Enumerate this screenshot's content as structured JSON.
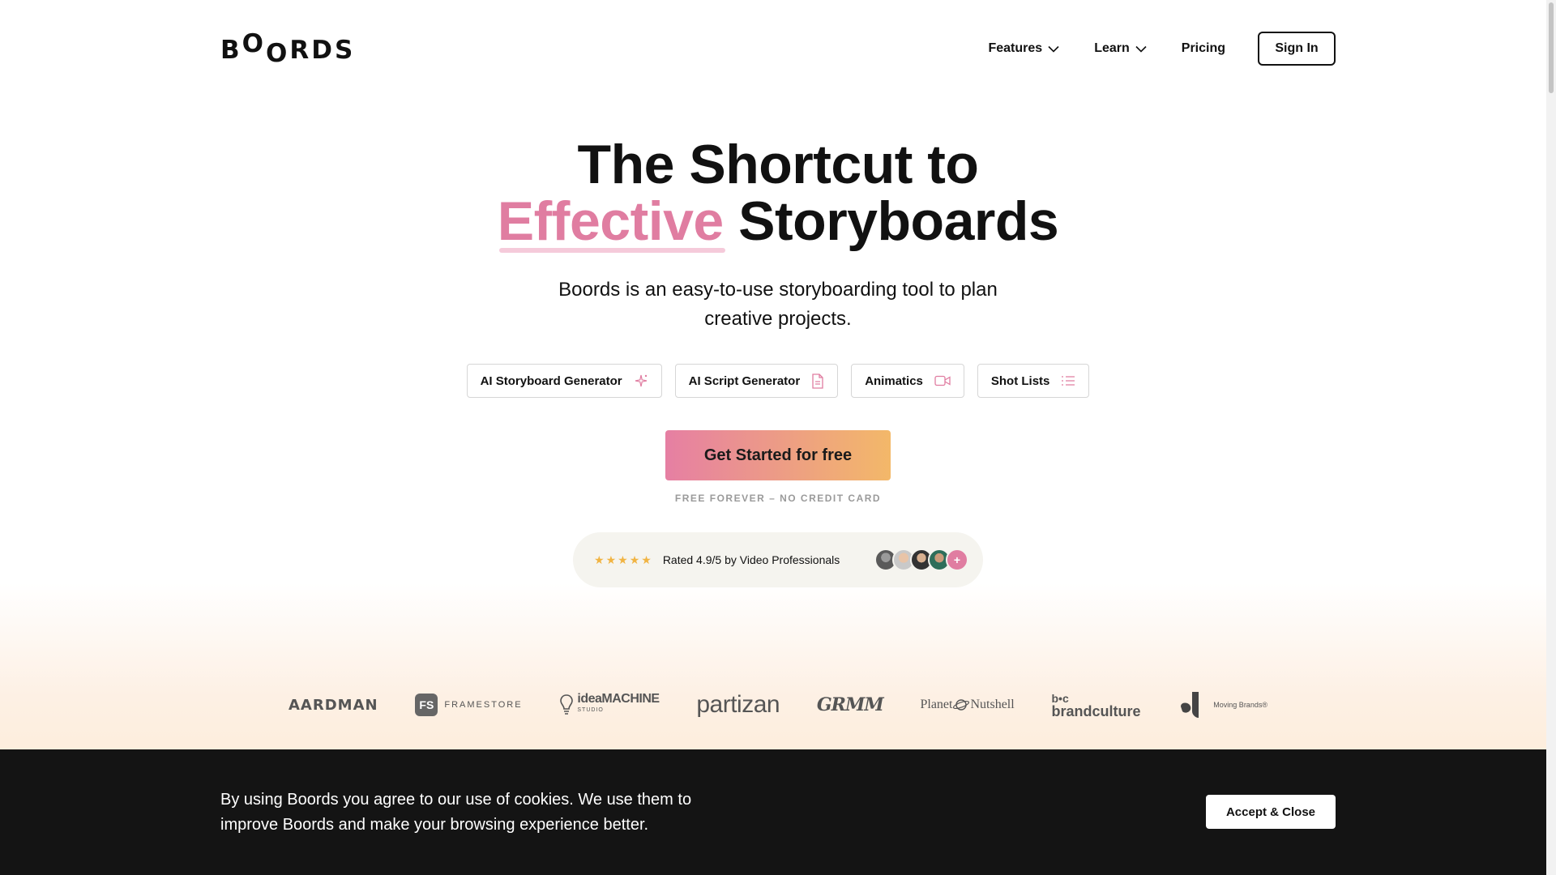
{
  "header": {
    "logo_letters": [
      "B",
      "O",
      "O",
      "R",
      "D",
      "S"
    ],
    "nav": [
      {
        "label": "Features",
        "has_dropdown": true
      },
      {
        "label": "Learn",
        "has_dropdown": true
      },
      {
        "label": "Pricing",
        "has_dropdown": false
      }
    ],
    "signin_label": "Sign In"
  },
  "hero": {
    "title_line1": "The Shortcut to",
    "title_accent": "Effective",
    "title_line2_rest": "Storyboards",
    "subtitle": "Boords is an easy-to-use storyboarding tool to plan creative projects.",
    "accent_color": "#e07da1"
  },
  "chips": [
    {
      "label": "AI Storyboard Generator",
      "icon": "sparkle-icon"
    },
    {
      "label": "AI Script Generator",
      "icon": "document-icon"
    },
    {
      "label": "Animatics",
      "icon": "video-camera-icon"
    },
    {
      "label": "Shot Lists",
      "icon": "list-icon"
    }
  ],
  "cta": {
    "label": "Get Started for free",
    "note": "FREE FOREVER – NO CREDIT CARD",
    "gradient_start": "#e67fa3",
    "gradient_end": "#f3b869"
  },
  "rating": {
    "stars": 5,
    "text": "Rated 4.9/5 by Video Professionals",
    "more_label": "+"
  },
  "client_logos": {
    "aardman": "AARDMAN",
    "framestore_mark": "FS",
    "framestore": "FRAMESTORE",
    "ideamachine": "ideaMACHINE",
    "ideamachine_sub": "STUDIO",
    "partizan": "partizan",
    "grimm": "GRMM",
    "planet": "Planet",
    "nutshell": "Nutshell",
    "bc_mark": "b•c",
    "brandculture": "brandculture",
    "moving": "Moving Brands®"
  },
  "cookie": {
    "text": "By using Boords you agree to our use of cookies. We use them to improve Boords and make your browsing experience better.",
    "button_label": "Accept & Close"
  }
}
